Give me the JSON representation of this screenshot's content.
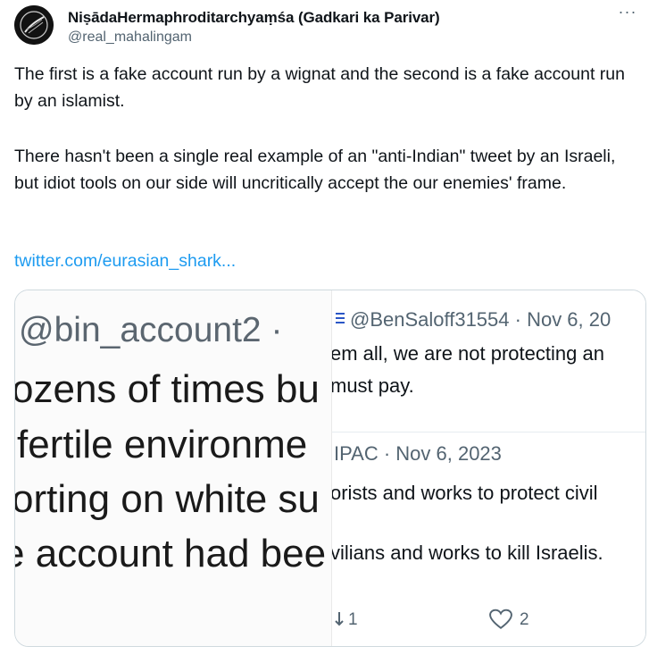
{
  "author": {
    "display_name": "NiṣādaHermaphroditarchyaṃśa (Gadkari ka Parivar)",
    "handle": "@real_mahalingam",
    "more_label": "···"
  },
  "tweet": {
    "paragraph1": "The first is a fake account run by a wignat and the second is a fake account run by an islamist.",
    "paragraph2": "There hasn't been a single real example of an \"anti-Indian\" tweet by an Israeli, but idiot tools on our side will uncritically accept the our enemies' frame.",
    "link": "twitter.com/eurasian_shark..."
  },
  "media": {
    "left_screenshot": {
      "handle": "@bin_account2 ·",
      "lines": [
        "ozens of times bu",
        "fertile environme",
        "orting on white su",
        "e account had bee"
      ]
    },
    "right_screenshot": {
      "tweet1_header": "@BenSaloff31554 · Nov 6, 20",
      "tweet1_line1": "em all, we are not protecting an",
      "tweet1_line2": "must pay.",
      "tweet2_header": "IPAC · Nov 6, 2023",
      "tweet2_line1": "orists and works to protect civil",
      "tweet2_line2": "vilians and works to kill Israelis.",
      "reply_count": "1",
      "like_count": "2"
    }
  },
  "colors": {
    "link": "#1d9bf0",
    "secondary_text": "#536471",
    "border": "#cfd9de"
  }
}
